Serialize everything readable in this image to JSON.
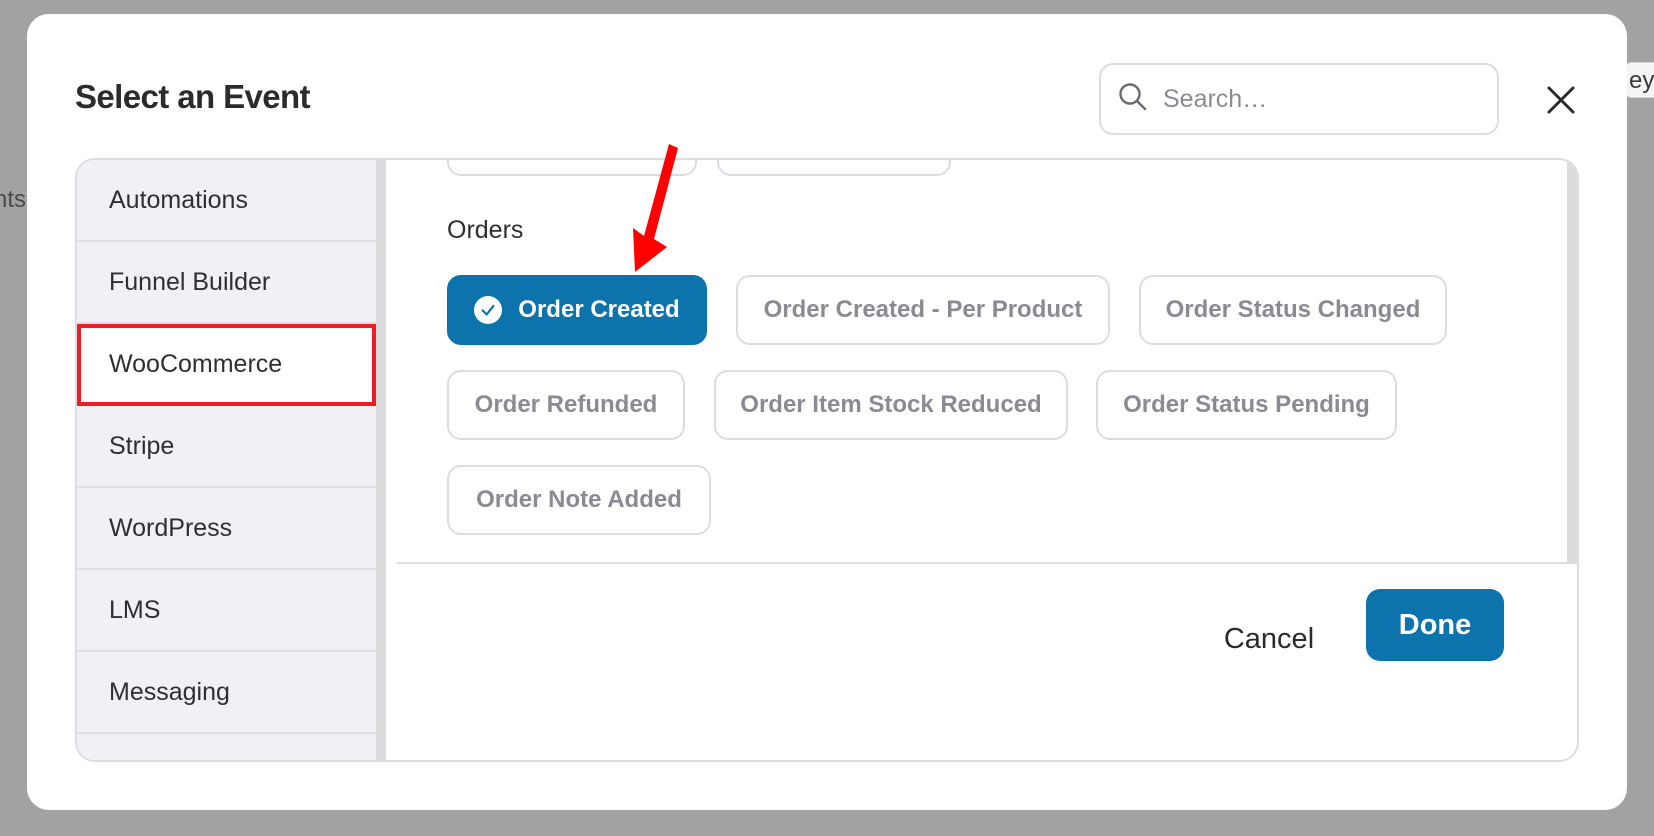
{
  "background": {
    "left_fragment": "nts",
    "right_fragment": "ey"
  },
  "modal": {
    "title": "Select an Event",
    "search_placeholder": "Search…",
    "close_icon": "close-icon"
  },
  "sidebar": {
    "items": [
      {
        "label": "Automations"
      },
      {
        "label": "Funnel Builder"
      },
      {
        "label": "WooCommerce",
        "highlighted": true
      },
      {
        "label": "Stripe"
      },
      {
        "label": "WordPress"
      },
      {
        "label": "LMS"
      },
      {
        "label": "Messaging"
      }
    ]
  },
  "events": {
    "section_title": "Orders",
    "chips": [
      {
        "label": "Order Created",
        "selected": true
      },
      {
        "label": "Order Created - Per Product",
        "selected": false
      },
      {
        "label": "Order Status Changed",
        "selected": false
      },
      {
        "label": "Order Refunded",
        "selected": false
      },
      {
        "label": "Order Item Stock Reduced",
        "selected": false
      },
      {
        "label": "Order Status Pending",
        "selected": false
      },
      {
        "label": "Order Note Added",
        "selected": false
      }
    ]
  },
  "footer": {
    "cancel_label": "Cancel",
    "done_label": "Done"
  },
  "colors": {
    "accent": "#0d73ad",
    "highlight_border": "#ee1c25",
    "annotation_arrow": "#ff0000"
  }
}
